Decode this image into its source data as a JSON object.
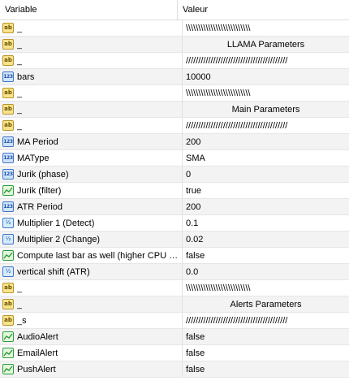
{
  "header": {
    "variable": "Variable",
    "value": "Valeur"
  },
  "rows": [
    {
      "type": "string",
      "icon": "string-type-icon",
      "name": "_",
      "value": "\\\\\\\\\\\\\\\\\\\\\\\\\\\\\\\\\\\\\\\\\\\\\\\\\\\\",
      "centered": false
    },
    {
      "type": "string",
      "icon": "string-type-icon",
      "name": "_",
      "value": "LLAMA Parameters",
      "centered": true
    },
    {
      "type": "string",
      "icon": "string-type-icon",
      "name": "_",
      "value": "/////////////////////////////////////////",
      "centered": false
    },
    {
      "type": "int",
      "icon": "integer-type-icon",
      "name": "bars",
      "value": "10000",
      "centered": false
    },
    {
      "type": "string",
      "icon": "string-type-icon",
      "name": "_",
      "value": "\\\\\\\\\\\\\\\\\\\\\\\\\\\\\\\\\\\\\\\\\\\\\\\\\\\\",
      "centered": false
    },
    {
      "type": "string",
      "icon": "string-type-icon",
      "name": "_",
      "value": "Main Parameters",
      "centered": true
    },
    {
      "type": "string",
      "icon": "string-type-icon",
      "name": "_",
      "value": "/////////////////////////////////////////",
      "centered": false
    },
    {
      "type": "int",
      "icon": "integer-type-icon",
      "name": "MA Period",
      "value": "200",
      "centered": false
    },
    {
      "type": "int",
      "icon": "integer-type-icon",
      "name": "MAType",
      "value": "SMA",
      "centered": false
    },
    {
      "type": "int",
      "icon": "integer-type-icon",
      "name": "Jurik (phase)",
      "value": "0",
      "centered": false
    },
    {
      "type": "bool",
      "icon": "boolean-type-icon",
      "name": "Jurik (filter)",
      "value": "true",
      "centered": false
    },
    {
      "type": "int",
      "icon": "integer-type-icon",
      "name": "ATR Period",
      "value": "200",
      "centered": false
    },
    {
      "type": "double",
      "icon": "double-type-icon",
      "name": "Multiplier 1 (Detect)",
      "value": "0.1",
      "centered": false
    },
    {
      "type": "double",
      "icon": "double-type-icon",
      "name": "Multiplier 2 (Change)",
      "value": "0.02",
      "centered": false
    },
    {
      "type": "bool",
      "icon": "boolean-type-icon",
      "name": "Compute last bar as well (higher CPU us...",
      "value": "false",
      "centered": false
    },
    {
      "type": "double",
      "icon": "double-type-icon",
      "name": "vertical shift (ATR)",
      "value": "0.0",
      "centered": false
    },
    {
      "type": "string",
      "icon": "string-type-icon",
      "name": "_",
      "value": "\\\\\\\\\\\\\\\\\\\\\\\\\\\\\\\\\\\\\\\\\\\\\\\\\\\\",
      "centered": false
    },
    {
      "type": "string",
      "icon": "string-type-icon",
      "name": "_",
      "value": "Alerts Parameters",
      "centered": true
    },
    {
      "type": "string",
      "icon": "string-type-icon",
      "name": "_s",
      "value": "/////////////////////////////////////////",
      "centered": false
    },
    {
      "type": "bool",
      "icon": "boolean-type-icon",
      "name": "AudioAlert",
      "value": "false",
      "centered": false
    },
    {
      "type": "bool",
      "icon": "boolean-type-icon",
      "name": "EmailAlert",
      "value": "false",
      "centered": false
    },
    {
      "type": "bool",
      "icon": "boolean-type-icon",
      "name": "PushAlert",
      "value": "false",
      "centered": false
    }
  ],
  "icon_glyphs": {
    "string": "ab",
    "int": "123",
    "double": "½"
  }
}
